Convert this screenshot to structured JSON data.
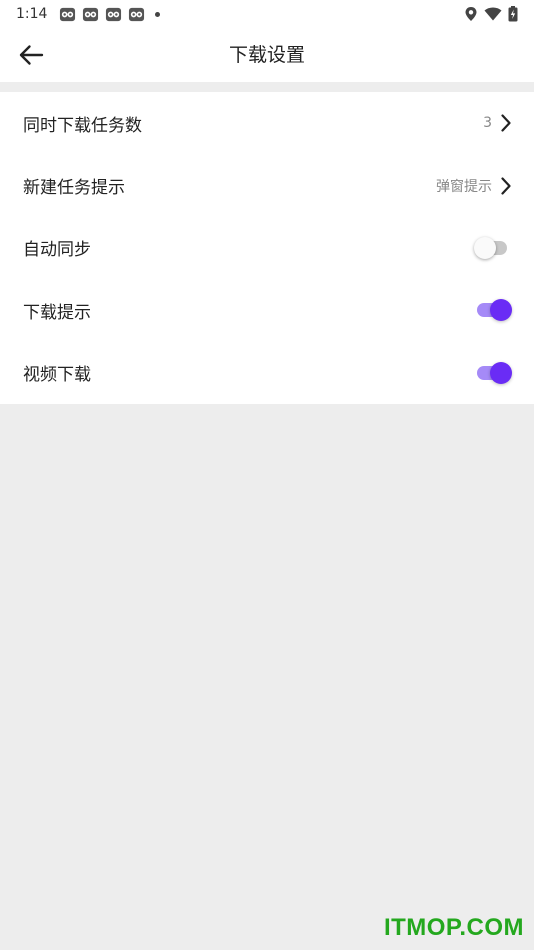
{
  "status_bar": {
    "time": "1:14",
    "notification_icons": [
      "app-notification-icon",
      "app-notification-icon",
      "app-notification-icon",
      "app-notification-icon"
    ],
    "right_icons": [
      "location-icon",
      "wifi-icon",
      "battery-charging-icon"
    ]
  },
  "header": {
    "title": "下载设置",
    "back_icon": "arrow-left-icon"
  },
  "settings": {
    "items": [
      {
        "label": "同时下载任务数",
        "value": "3",
        "kind": "chevron"
      },
      {
        "label": "新建任务提示",
        "value": "弹窗提示",
        "kind": "chevron"
      },
      {
        "label": "自动同步",
        "kind": "toggle",
        "on": false
      },
      {
        "label": "下载提示",
        "kind": "toggle",
        "on": true
      },
      {
        "label": "视频下载",
        "kind": "toggle",
        "on": true
      }
    ]
  },
  "colors": {
    "accent": "#6a2cf5",
    "accent_track": "#a58af7",
    "background": "#ededed",
    "watermark": "#24a81e"
  },
  "watermark": {
    "text": "ITMOP.COM"
  }
}
